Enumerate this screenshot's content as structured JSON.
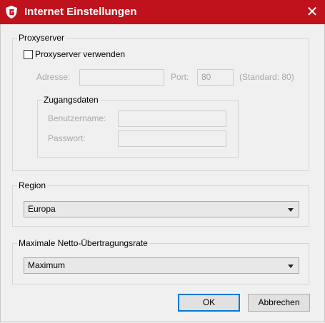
{
  "window": {
    "title": "Internet Einstellungen",
    "close_glyph": "✕",
    "brand_color": "#c0121c",
    "logo_icon": "gdata-g-shield-icon"
  },
  "proxy": {
    "group_label": "Proxyserver",
    "use_proxy_label": "Proxyserver verwenden",
    "use_proxy_checked": false,
    "address_label": "Adresse:",
    "address_value": "",
    "port_label": "Port:",
    "port_value": "80",
    "port_hint": "(Standard: 80)",
    "credentials": {
      "group_label": "Zugangsdaten",
      "username_label": "Benutzername:",
      "username_value": "",
      "password_label": "Passwort:",
      "password_value": ""
    }
  },
  "region": {
    "group_label": "Region",
    "selected": "Europa"
  },
  "rate": {
    "group_label": "Maximale Netto-Übertragungsrate",
    "selected": "Maximum"
  },
  "buttons": {
    "ok": "OK",
    "cancel": "Abbrechen"
  }
}
